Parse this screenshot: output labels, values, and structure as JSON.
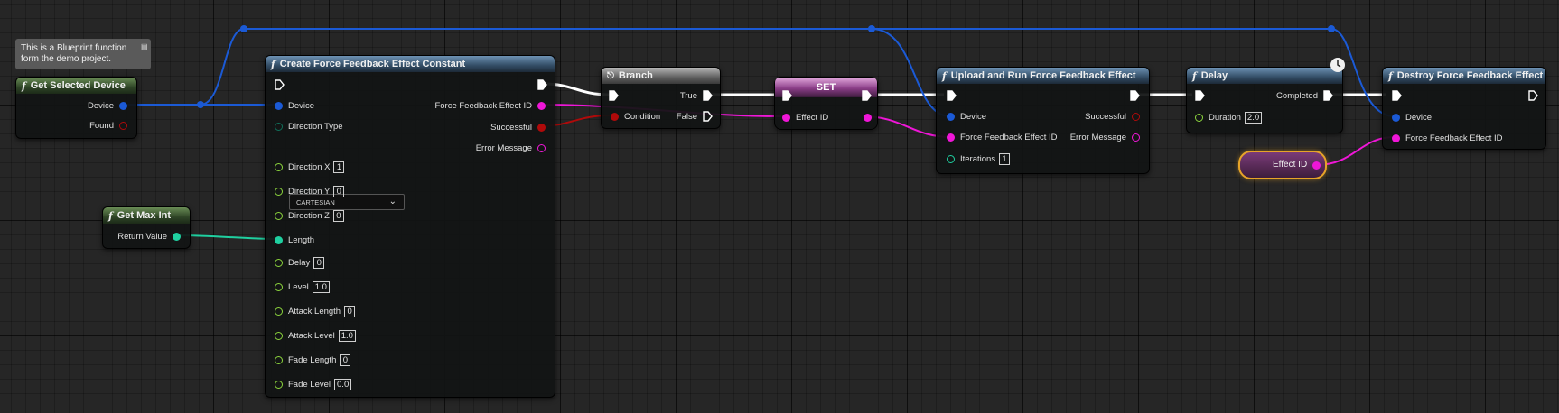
{
  "comment": {
    "text": "This is a Blueprint function form the demo project."
  },
  "nodes": {
    "get_selected_device": {
      "title": "Get Selected Device",
      "out_device": "Device",
      "out_found": "Found"
    },
    "get_max_int": {
      "title": "Get Max Int",
      "out_return": "Return Value"
    },
    "create_ffe": {
      "title": "Create Force Feedback Effect Constant",
      "in_device": "Device",
      "in_direction_type": "Direction Type",
      "direction_type_value": "CARTESIAN",
      "in_direction_x": "Direction X",
      "direction_x_value": "1",
      "in_direction_y": "Direction Y",
      "direction_y_value": "0",
      "in_direction_z": "Direction Z",
      "direction_z_value": "0",
      "in_length": "Length",
      "in_delay": "Delay",
      "delay_value": "0",
      "in_level": "Level",
      "level_value": "1.0",
      "in_attack_length": "Attack Length",
      "attack_length_value": "0",
      "in_attack_level": "Attack Level",
      "attack_level_value": "1.0",
      "in_fade_length": "Fade Length",
      "fade_length_value": "0",
      "in_fade_level": "Fade Level",
      "fade_level_value": "0.0",
      "out_effect_id": "Force Feedback Effect ID",
      "out_successful": "Successful",
      "out_error_message": "Error Message"
    },
    "branch": {
      "title": "Branch",
      "in_condition": "Condition",
      "out_true": "True",
      "out_false": "False"
    },
    "set": {
      "title": "SET",
      "in_effect_id": "Effect ID"
    },
    "upload_run": {
      "title": "Upload and Run Force Feedback Effect",
      "in_device": "Device",
      "in_effect_id": "Force Feedback Effect ID",
      "in_iterations": "Iterations",
      "iterations_value": "1",
      "out_successful": "Successful",
      "out_error_message": "Error Message"
    },
    "delay": {
      "title": "Delay",
      "in_duration": "Duration",
      "duration_value": "2.0",
      "out_completed": "Completed"
    },
    "destroy": {
      "title": "Destroy Force Feedback Effect",
      "in_device": "Device",
      "in_effect_id": "Force Feedback Effect ID"
    },
    "effect_id_var": {
      "label": "Effect ID"
    }
  },
  "colors": {
    "grid_background": "#262626",
    "exec_pin": "#ffffff",
    "struct_pin": "#1b5ad6",
    "bool_pin": "#b00a0a",
    "int_pin": "#1fd0a0",
    "float_pin": "#8bd43d",
    "effect_id_pin": "#f016d8",
    "string_pin": "#f016d8",
    "enum_pin": "#10705a",
    "selection_outline": "#e7a428"
  },
  "icons": {
    "function": "function-icon",
    "branch": "branch-icon",
    "latent": "clock-icon",
    "comment": "comment-bubble-icon"
  }
}
